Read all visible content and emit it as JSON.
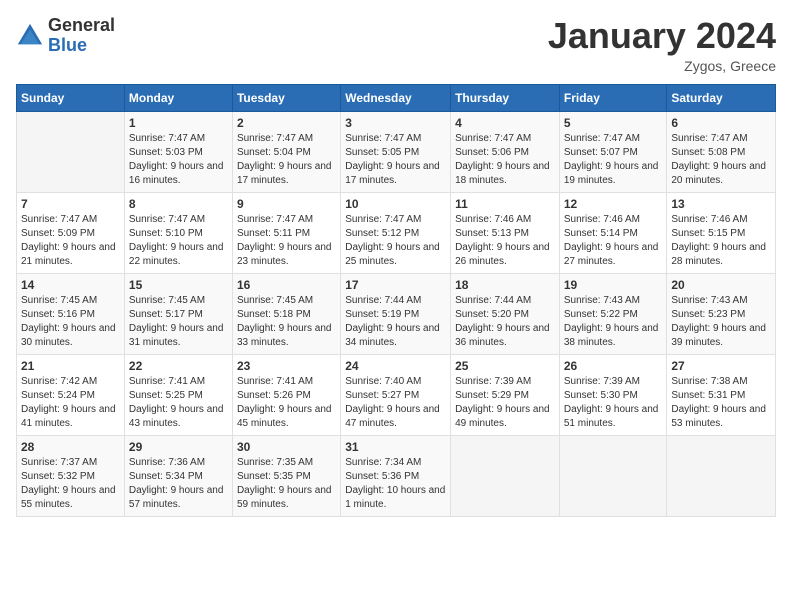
{
  "header": {
    "logo_general": "General",
    "logo_blue": "Blue",
    "month_title": "January 2024",
    "location": "Zygos, Greece"
  },
  "days_of_week": [
    "Sunday",
    "Monday",
    "Tuesday",
    "Wednesday",
    "Thursday",
    "Friday",
    "Saturday"
  ],
  "weeks": [
    [
      {
        "day": "",
        "sunrise": "",
        "sunset": "",
        "daylight": ""
      },
      {
        "day": "1",
        "sunrise": "Sunrise: 7:47 AM",
        "sunset": "Sunset: 5:03 PM",
        "daylight": "Daylight: 9 hours and 16 minutes."
      },
      {
        "day": "2",
        "sunrise": "Sunrise: 7:47 AM",
        "sunset": "Sunset: 5:04 PM",
        "daylight": "Daylight: 9 hours and 17 minutes."
      },
      {
        "day": "3",
        "sunrise": "Sunrise: 7:47 AM",
        "sunset": "Sunset: 5:05 PM",
        "daylight": "Daylight: 9 hours and 17 minutes."
      },
      {
        "day": "4",
        "sunrise": "Sunrise: 7:47 AM",
        "sunset": "Sunset: 5:06 PM",
        "daylight": "Daylight: 9 hours and 18 minutes."
      },
      {
        "day": "5",
        "sunrise": "Sunrise: 7:47 AM",
        "sunset": "Sunset: 5:07 PM",
        "daylight": "Daylight: 9 hours and 19 minutes."
      },
      {
        "day": "6",
        "sunrise": "Sunrise: 7:47 AM",
        "sunset": "Sunset: 5:08 PM",
        "daylight": "Daylight: 9 hours and 20 minutes."
      }
    ],
    [
      {
        "day": "7",
        "sunrise": "Sunrise: 7:47 AM",
        "sunset": "Sunset: 5:09 PM",
        "daylight": "Daylight: 9 hours and 21 minutes."
      },
      {
        "day": "8",
        "sunrise": "Sunrise: 7:47 AM",
        "sunset": "Sunset: 5:10 PM",
        "daylight": "Daylight: 9 hours and 22 minutes."
      },
      {
        "day": "9",
        "sunrise": "Sunrise: 7:47 AM",
        "sunset": "Sunset: 5:11 PM",
        "daylight": "Daylight: 9 hours and 23 minutes."
      },
      {
        "day": "10",
        "sunrise": "Sunrise: 7:47 AM",
        "sunset": "Sunset: 5:12 PM",
        "daylight": "Daylight: 9 hours and 25 minutes."
      },
      {
        "day": "11",
        "sunrise": "Sunrise: 7:46 AM",
        "sunset": "Sunset: 5:13 PM",
        "daylight": "Daylight: 9 hours and 26 minutes."
      },
      {
        "day": "12",
        "sunrise": "Sunrise: 7:46 AM",
        "sunset": "Sunset: 5:14 PM",
        "daylight": "Daylight: 9 hours and 27 minutes."
      },
      {
        "day": "13",
        "sunrise": "Sunrise: 7:46 AM",
        "sunset": "Sunset: 5:15 PM",
        "daylight": "Daylight: 9 hours and 28 minutes."
      }
    ],
    [
      {
        "day": "14",
        "sunrise": "Sunrise: 7:45 AM",
        "sunset": "Sunset: 5:16 PM",
        "daylight": "Daylight: 9 hours and 30 minutes."
      },
      {
        "day": "15",
        "sunrise": "Sunrise: 7:45 AM",
        "sunset": "Sunset: 5:17 PM",
        "daylight": "Daylight: 9 hours and 31 minutes."
      },
      {
        "day": "16",
        "sunrise": "Sunrise: 7:45 AM",
        "sunset": "Sunset: 5:18 PM",
        "daylight": "Daylight: 9 hours and 33 minutes."
      },
      {
        "day": "17",
        "sunrise": "Sunrise: 7:44 AM",
        "sunset": "Sunset: 5:19 PM",
        "daylight": "Daylight: 9 hours and 34 minutes."
      },
      {
        "day": "18",
        "sunrise": "Sunrise: 7:44 AM",
        "sunset": "Sunset: 5:20 PM",
        "daylight": "Daylight: 9 hours and 36 minutes."
      },
      {
        "day": "19",
        "sunrise": "Sunrise: 7:43 AM",
        "sunset": "Sunset: 5:22 PM",
        "daylight": "Daylight: 9 hours and 38 minutes."
      },
      {
        "day": "20",
        "sunrise": "Sunrise: 7:43 AM",
        "sunset": "Sunset: 5:23 PM",
        "daylight": "Daylight: 9 hours and 39 minutes."
      }
    ],
    [
      {
        "day": "21",
        "sunrise": "Sunrise: 7:42 AM",
        "sunset": "Sunset: 5:24 PM",
        "daylight": "Daylight: 9 hours and 41 minutes."
      },
      {
        "day": "22",
        "sunrise": "Sunrise: 7:41 AM",
        "sunset": "Sunset: 5:25 PM",
        "daylight": "Daylight: 9 hours and 43 minutes."
      },
      {
        "day": "23",
        "sunrise": "Sunrise: 7:41 AM",
        "sunset": "Sunset: 5:26 PM",
        "daylight": "Daylight: 9 hours and 45 minutes."
      },
      {
        "day": "24",
        "sunrise": "Sunrise: 7:40 AM",
        "sunset": "Sunset: 5:27 PM",
        "daylight": "Daylight: 9 hours and 47 minutes."
      },
      {
        "day": "25",
        "sunrise": "Sunrise: 7:39 AM",
        "sunset": "Sunset: 5:29 PM",
        "daylight": "Daylight: 9 hours and 49 minutes."
      },
      {
        "day": "26",
        "sunrise": "Sunrise: 7:39 AM",
        "sunset": "Sunset: 5:30 PM",
        "daylight": "Daylight: 9 hours and 51 minutes."
      },
      {
        "day": "27",
        "sunrise": "Sunrise: 7:38 AM",
        "sunset": "Sunset: 5:31 PM",
        "daylight": "Daylight: 9 hours and 53 minutes."
      }
    ],
    [
      {
        "day": "28",
        "sunrise": "Sunrise: 7:37 AM",
        "sunset": "Sunset: 5:32 PM",
        "daylight": "Daylight: 9 hours and 55 minutes."
      },
      {
        "day": "29",
        "sunrise": "Sunrise: 7:36 AM",
        "sunset": "Sunset: 5:34 PM",
        "daylight": "Daylight: 9 hours and 57 minutes."
      },
      {
        "day": "30",
        "sunrise": "Sunrise: 7:35 AM",
        "sunset": "Sunset: 5:35 PM",
        "daylight": "Daylight: 9 hours and 59 minutes."
      },
      {
        "day": "31",
        "sunrise": "Sunrise: 7:34 AM",
        "sunset": "Sunset: 5:36 PM",
        "daylight": "Daylight: 10 hours and 1 minute."
      },
      {
        "day": "",
        "sunrise": "",
        "sunset": "",
        "daylight": ""
      },
      {
        "day": "",
        "sunrise": "",
        "sunset": "",
        "daylight": ""
      },
      {
        "day": "",
        "sunrise": "",
        "sunset": "",
        "daylight": ""
      }
    ]
  ]
}
